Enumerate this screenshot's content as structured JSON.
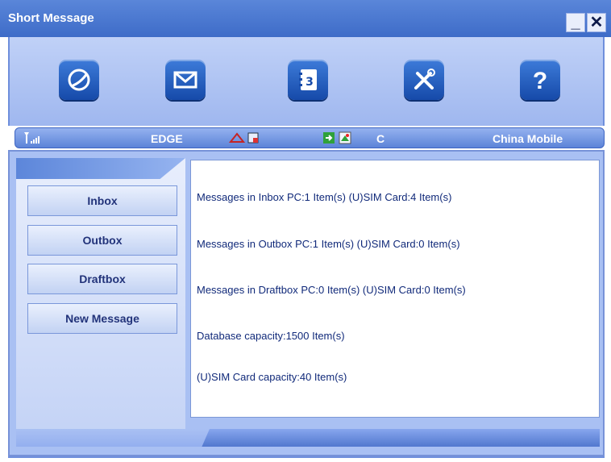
{
  "window": {
    "title": "Short Message",
    "minimize_glyph": "_",
    "close_glyph": "✕"
  },
  "toolbar": {
    "items": [
      {
        "name": "internet-icon"
      },
      {
        "name": "message-icon"
      },
      {
        "name": "contacts-icon"
      },
      {
        "name": "settings-icon"
      },
      {
        "name": "help-icon",
        "glyph": "?"
      }
    ]
  },
  "status": {
    "network_type": "EDGE",
    "roaming_flag": "C",
    "operator": "China Mobile",
    "signal_icon": "signal-icon"
  },
  "sidebar": {
    "items": [
      {
        "label": "Inbox"
      },
      {
        "label": "Outbox"
      },
      {
        "label": "Draftbox"
      },
      {
        "label": "New Message"
      }
    ]
  },
  "content": {
    "lines": [
      "Messages in Inbox PC:1 Item(s)  (U)SIM Card:4 Item(s)",
      "Messages in Outbox PC:1 Item(s)  (U)SIM Card:0 Item(s)",
      "Messages in Draftbox PC:0 Item(s)  (U)SIM Card:0 Item(s)",
      "Database capacity:1500 Item(s)",
      "(U)SIM Card capacity:40 Item(s)"
    ]
  },
  "colors": {
    "titlebar": "#4a78d2",
    "status_text": "#ffffff",
    "content_text": "#112a7a"
  }
}
